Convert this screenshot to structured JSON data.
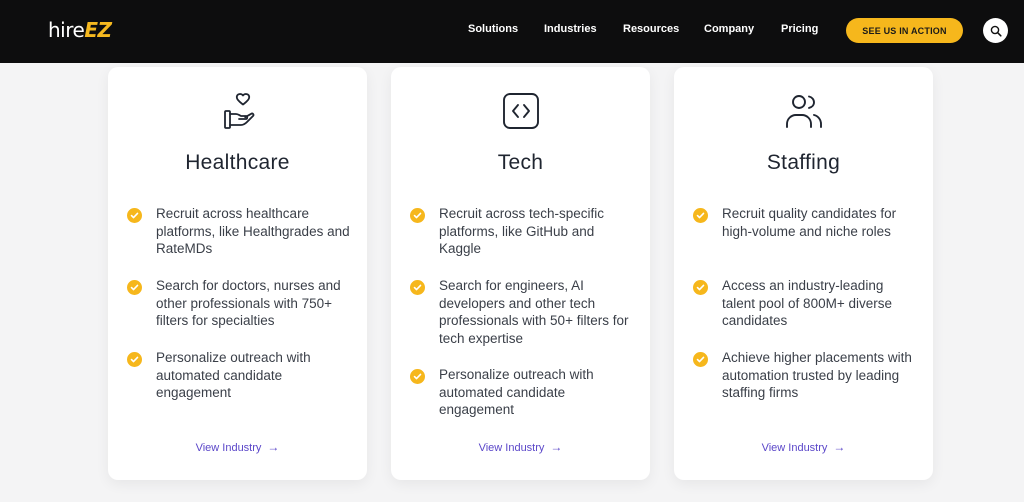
{
  "nav": {
    "logo_hire": "hire",
    "logo_ez": "EZ",
    "links": [
      "Solutions",
      "Industries",
      "Resources",
      "Company",
      "Pricing"
    ],
    "cta_label": "SEE US IN ACTION",
    "search_icon": "search-icon"
  },
  "colors": {
    "accent": "#f6b71c",
    "link": "#5b47c9",
    "nav_bg": "#0d0d0e"
  },
  "cards": [
    {
      "icon": "hand-heart-icon",
      "title": "Healthcare",
      "bullets": [
        "Recruit across healthcare platforms, like Healthgrades and RateMDs",
        "Search for doctors, nurses and other professionals with 750+ filters for specialties",
        "Personalize outreach with automated candidate engagement"
      ],
      "link_label": "View Industry"
    },
    {
      "icon": "code-icon",
      "title": "Tech",
      "bullets": [
        "Recruit across tech-specific platforms, like GitHub and Kaggle",
        "Search for engineers, AI developers and other tech professionals with 50+ filters for tech expertise",
        "Personalize outreach with automated candidate engagement"
      ],
      "link_label": "View Industry"
    },
    {
      "icon": "users-icon",
      "title": "Staffing",
      "bullets": [
        "Recruit quality candidates for high-volume and niche roles",
        "Access an industry-leading talent pool of 800M+ diverse candidates",
        "Achieve higher placements with automation trusted by leading staffing firms"
      ],
      "link_label": "View Industry"
    }
  ]
}
